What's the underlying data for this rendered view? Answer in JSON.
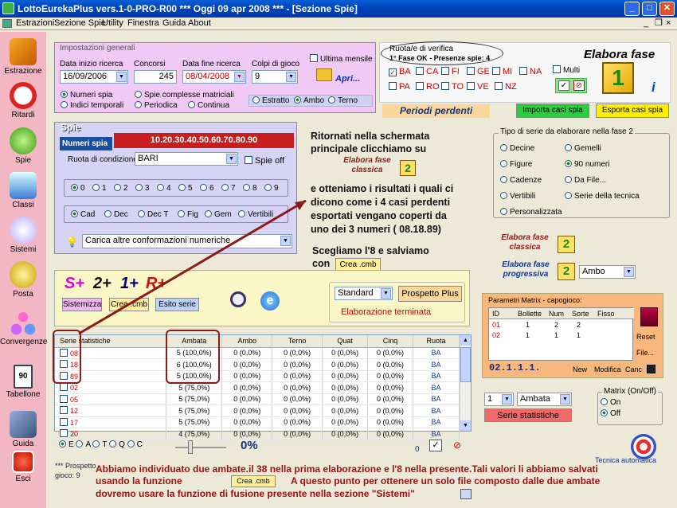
{
  "window": {
    "title": "LottoEurekaPlus vers.1-0-PRO-R00  ***  Oggi 09 apr 2008  ***   - [Sezione Spie]",
    "btn_min": "_",
    "btn_max": "□",
    "btn_close": "✕"
  },
  "menu": [
    "Estrazioni",
    "Sezione Spie",
    "Utility",
    "Finestra",
    "Guida",
    "About"
  ],
  "sidebar": [
    "Estrazione",
    "Ritardi",
    "Spie",
    "Classi",
    "Sistemi",
    "Posta",
    "Convergenze",
    "Tabellone",
    "Guida",
    "Esci"
  ],
  "tabellone_num": "90",
  "impostazioni": {
    "title": "Impostazioni generali",
    "data_inizio_label": "Data inizio ricerca",
    "data_inizio": "16/09/2006",
    "concorsi_label": "Concorsi",
    "concorsi": "245",
    "data_fine_label": "Data fine ricerca",
    "data_fine": "08/04/2008",
    "colpi_label": "Colpi di gioco",
    "colpi": "9",
    "ultima_mensile": "Ultima mensile",
    "apri": "Apri...",
    "numeri_spia": "Numeri spia",
    "indici_temporali": "Indici temporali",
    "spie_complesse": "Spie complesse matriciali",
    "periodica": "Periodica",
    "continua": "Continua",
    "estratto": "Estratto",
    "ambo": "Ambo",
    "terno": "Terno"
  },
  "ruota_verifica": {
    "title": "Ruota/e di verifica",
    "status": "1° Fase OK - Presenze spie: 4",
    "ruote_row1": [
      "BA",
      "CA",
      "FI",
      "GE",
      "MI",
      "NA"
    ],
    "ruote_row2": [
      "PA",
      "RO",
      "TO",
      "VE",
      "NZ"
    ],
    "multi": "Multi",
    "elabora_fase": "Elabora fase",
    "fase_num": "1"
  },
  "periodi_perdenti": "Periodi perdenti",
  "importa": "Importa casi spia",
  "esporta": "Esporta casi spia",
  "spie": {
    "title": "Spie",
    "numeri_label": "Numeri spia",
    "numeri_value": "10.20.30.40.50.60.70.80.90",
    "ruota_cond_label": "Ruota di condizione",
    "ruota_cond": "BARI",
    "spie_off": "Spie off",
    "digits": [
      "0",
      "1",
      "2",
      "3",
      "4",
      "5",
      "6",
      "7",
      "8",
      "9"
    ],
    "mode": [
      "Cad",
      "Dec",
      "Dec T",
      "Fig",
      "Gem",
      "Vertibili"
    ],
    "carica": "Carica altre conformazioni numeriche"
  },
  "annotation": {
    "l1": "Ritornati nella schermata",
    "l2": "principale clicchiamo su",
    "elab_classica": "Elabora fase classica",
    "l3": "e otteniamo i risultati i quali ci",
    "l4": "dicono come i 4 casi perdenti",
    "l5": "esportati vengano coperti da",
    "l6": "uno dei 3 numeri ( 08.18.89)",
    "l7": "Scegliamo l'8 e salviamo",
    "l8": "con",
    "crea": "Crea .cmb"
  },
  "tipo_serie": {
    "title": "Tipo di serie da elaborare nella fase 2",
    "opts_left": [
      "Decine",
      "Figure",
      "Cadenze",
      "Vertibili",
      "Personalizzata"
    ],
    "opts_right": [
      "Gemelli",
      "90 numeri",
      "Da File...",
      "Serie della tecnica"
    ],
    "elab_classica": "Elabora fase classica",
    "elab_progressiva": "Elabora fase progressiva",
    "fase_num": "2",
    "ambo": "Ambo"
  },
  "smart": {
    "s": "S+",
    "n2": "2+",
    "n1": "1+",
    "r": "R+",
    "sistemizza": "Sistemizza",
    "crea": "Crea .cmb",
    "esito": "Esito serie",
    "standard": "Standard",
    "prospetto": "Prospetto Plus",
    "terminata": "Elaborazione terminata"
  },
  "matrix": {
    "title": "Parametri Matrix - capogioco:",
    "headers": [
      "ID",
      "Bollette",
      "Num",
      "Sorte",
      "Fisso"
    ],
    "rows": [
      [
        "01",
        "1",
        "2",
        "2",
        ""
      ],
      [
        "02",
        "1",
        "1",
        "1",
        ""
      ]
    ],
    "reset": "Reset",
    "file": "File...",
    "code": "02.1.1.1.",
    "nuovo": "New",
    "modifica": "Modifica",
    "canc": "Canc"
  },
  "stats": {
    "headers": [
      "Serie statistiche",
      "Ambata",
      "Ambo",
      "Terno",
      "Quat",
      "Cinq",
      "Ruota"
    ],
    "rows": [
      [
        "08",
        "5 (100,0%)",
        "0 (0,0%)",
        "0 (0,0%)",
        "0 (0,0%)",
        "0 (0,0%)",
        "BA"
      ],
      [
        "18",
        "6 (100,0%)",
        "0 (0,0%)",
        "0 (0,0%)",
        "0 (0,0%)",
        "0 (0,0%)",
        "BA"
      ],
      [
        "89",
        "5 (100,0%)",
        "0 (0,0%)",
        "0 (0,0%)",
        "0 (0,0%)",
        "0 (0,0%)",
        "BA"
      ],
      [
        "02",
        "5 (75,0%)",
        "0 (0,0%)",
        "0 (0,0%)",
        "0 (0,0%)",
        "0 (0,0%)",
        "BA"
      ],
      [
        "05",
        "5 (75,0%)",
        "0 (0,0%)",
        "0 (0,0%)",
        "0 (0,0%)",
        "0 (0,0%)",
        "BA"
      ],
      [
        "12",
        "5 (75,0%)",
        "0 (0,0%)",
        "0 (0,0%)",
        "0 (0,0%)",
        "0 (0,0%)",
        "BA"
      ],
      [
        "17",
        "5 (75,0%)",
        "0 (0,0%)",
        "0 (0,0%)",
        "0 (0,0%)",
        "0 (0,0%)",
        "BA"
      ],
      [
        "20",
        "4 (75,0%)",
        "0 (0,0%)",
        "0 (0,0%)",
        "0 (0,0%)",
        "0 (0,0%)",
        "BA"
      ]
    ]
  },
  "bottom": {
    "radios": [
      "E",
      "A",
      "T",
      "Q",
      "C"
    ],
    "percent": "0%",
    "zero": "0",
    "prospetto": "*** Prospetto",
    "gioco": "gioco: 9",
    "sel_num": "1",
    "sel_ambata": "Ambata",
    "serie_stat": "Serie statistiche",
    "matrix_title": "Matrix (On/Off)",
    "on": "On",
    "off": "Off",
    "tecnica": "Tecnica automatica"
  },
  "footer": {
    "l1": "Abbiamo individuato due ambate.il 38 nella prima elaborazione e l'8 nella presente.Tali valori li abbiamo salvati",
    "l2a": "usando la funzione",
    "crea": "Crea .cmb",
    "l2b": "A questo punto per ottenere un solo file composto dalle due ambate",
    "l3": "dovremo usare la funzione di fusione presente nella sezione \"Sistemi\""
  }
}
